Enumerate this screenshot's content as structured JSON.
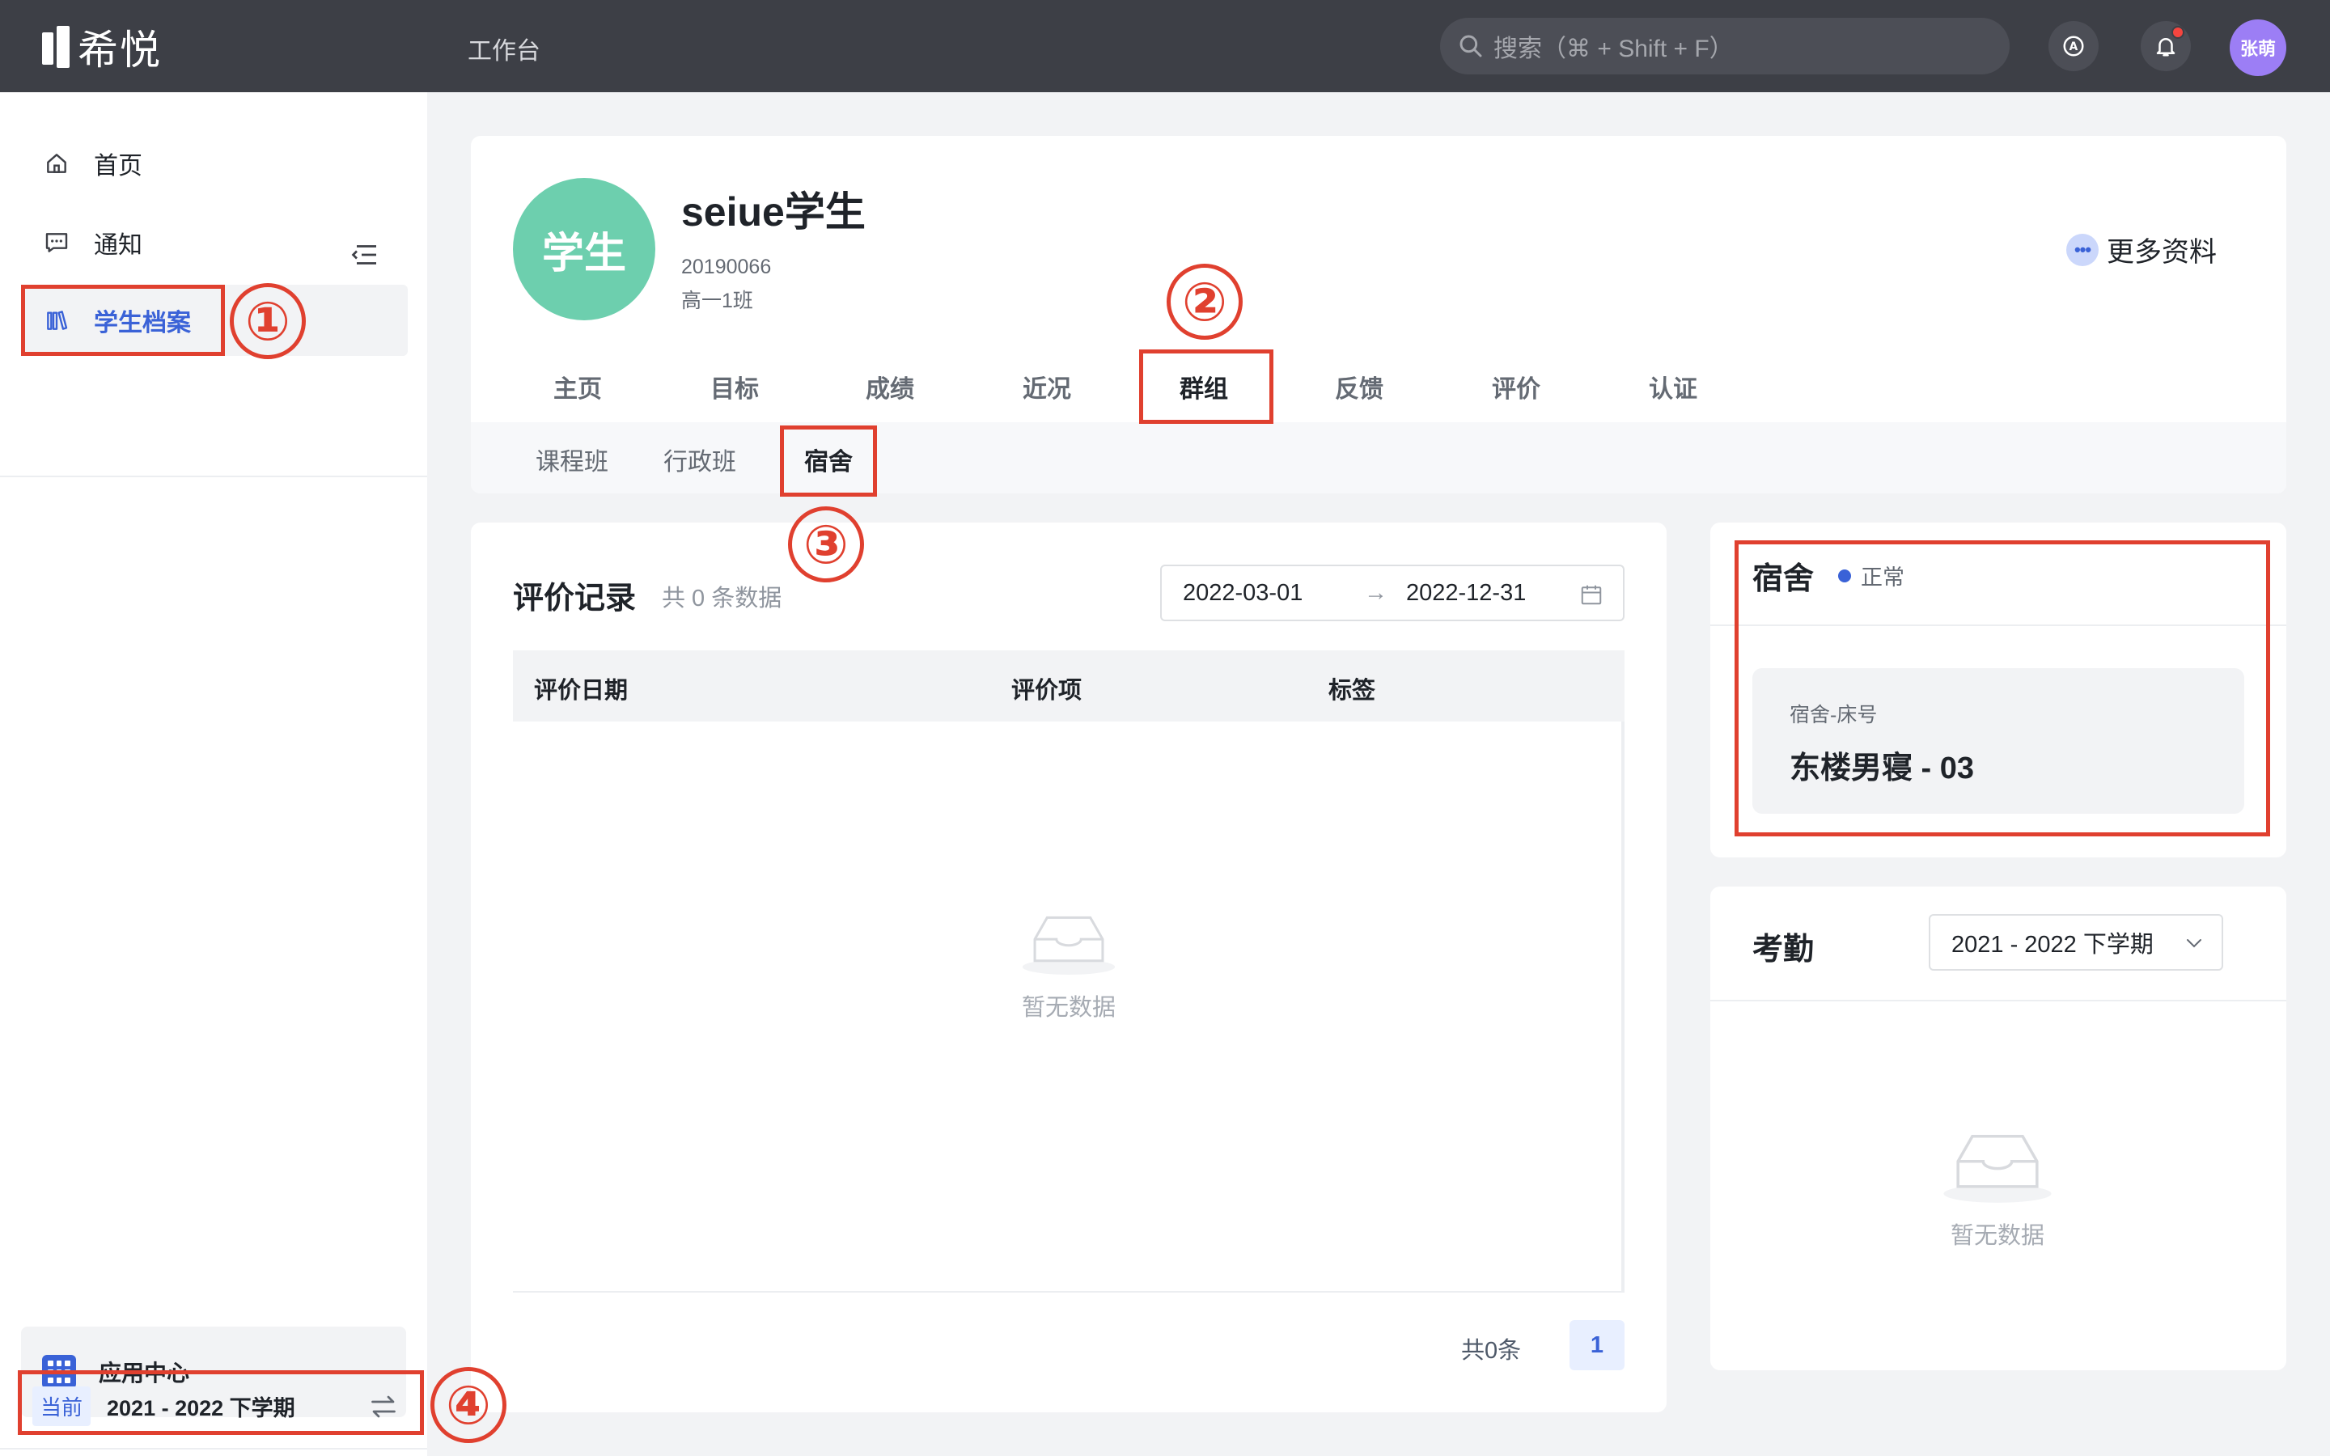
{
  "topbar": {
    "logo_text": "希悦",
    "workbench": "工作台",
    "search_placeholder": "搜索（⌘ + Shift + F）",
    "user_avatar": "张萌"
  },
  "sidebar": {
    "items": [
      {
        "label": "首页",
        "icon": "home-icon"
      },
      {
        "label": "通知",
        "icon": "message-icon"
      },
      {
        "label": "学生档案",
        "icon": "archive-icon",
        "active": true
      }
    ],
    "app_center": "应用中心",
    "term": {
      "tag": "当前",
      "label": "2021 - 2022 下学期"
    }
  },
  "profile": {
    "avatar_text": "学生",
    "name": "seiue学生",
    "student_id": "20190066",
    "class": "高一1班",
    "more_info": "更多资料",
    "tabs": [
      "主页",
      "目标",
      "成绩",
      "近况",
      "群组",
      "反馈",
      "评价",
      "认证"
    ],
    "active_tab": "群组",
    "subtabs": [
      "课程班",
      "行政班",
      "宿舍"
    ],
    "active_subtab": "宿舍"
  },
  "evaluation": {
    "title": "评价记录",
    "count": "共 0 条数据",
    "date_start": "2022-03-01",
    "date_sep": "→",
    "date_end": "2022-12-31",
    "columns": [
      "评价日期",
      "评价项",
      "标签"
    ],
    "empty_text": "暂无数据",
    "pager_total": "共0条",
    "pager_current": "1"
  },
  "dorm": {
    "title": "宿舍",
    "status": "正常",
    "bed_label": "宿舍-床号",
    "bed_value": "东楼男寝 - 03"
  },
  "attendance": {
    "title": "考勤",
    "term_select": "2021 - 2022 下学期",
    "empty_text": "暂无数据"
  },
  "annotations": [
    "①",
    "②",
    "③",
    "④"
  ],
  "colors": {
    "accent": "#3a62d7",
    "annotation": "#e0402f",
    "avatar": "#6dcfae",
    "topbar": "#3d3f46"
  }
}
